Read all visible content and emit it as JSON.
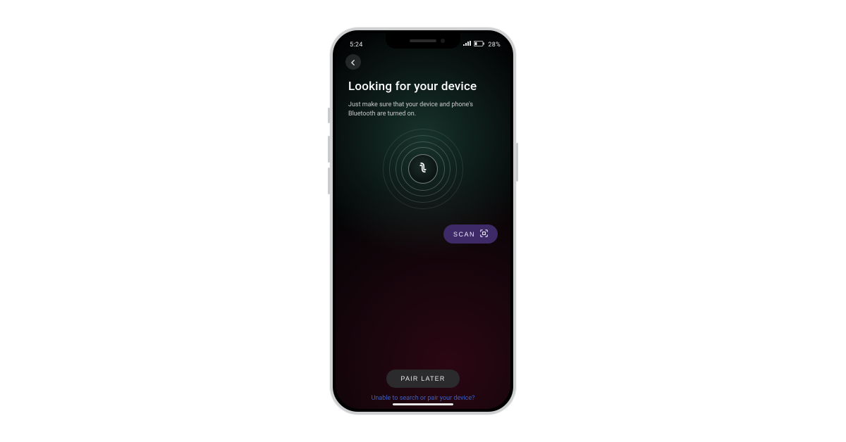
{
  "statusbar": {
    "time": "5:24",
    "battery": "28%"
  },
  "header": {
    "back_icon": "arrow-left"
  },
  "page": {
    "title": "Looking for your device",
    "subtitle": "Just make sure that your device and phone's Bluetooth are turned on."
  },
  "scan_button": {
    "label": "SCAN"
  },
  "footer": {
    "pair_later_label": "PAIR LATER",
    "help_link": "Unable to search or pair your device?"
  },
  "colors": {
    "accent": "#3e2a66",
    "link": "#3f5fbf"
  }
}
